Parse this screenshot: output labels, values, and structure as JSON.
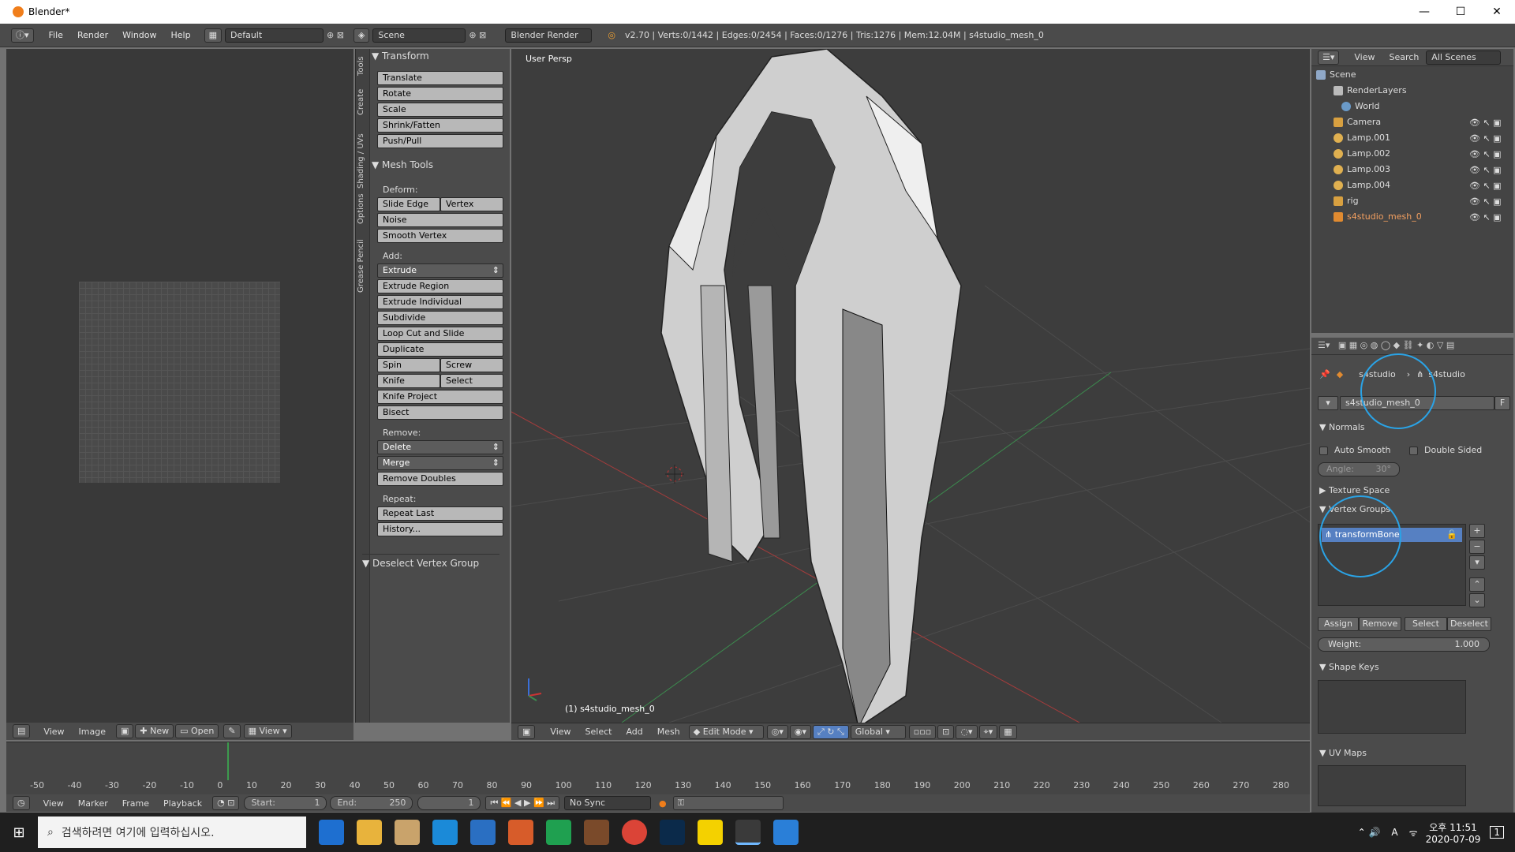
{
  "window": {
    "title": "Blender*",
    "minimize": "—",
    "maximize": "☐",
    "close": "✕"
  },
  "menubar": {
    "menus": [
      "File",
      "Render",
      "Window",
      "Help"
    ],
    "layout": "Default",
    "scene": "Scene",
    "engine": "Blender Render",
    "info": "v2.70 | Verts:0/1442 | Edges:0/2454 | Faces:0/1276 | Tris:1276 | Mem:12.04M | s4studio_mesh_0"
  },
  "tool_tabs": [
    "Tools",
    "Create",
    "Shading / UVs",
    "Options",
    "Grease Pencil"
  ],
  "toolshelf": {
    "transform_header": "Transform",
    "transform": [
      "Translate",
      "Rotate",
      "Scale",
      "Shrink/Fatten",
      "Push/Pull"
    ],
    "mesh_tools_header": "Mesh Tools",
    "deform_label": "Deform:",
    "slide_edge": "Slide Edge",
    "vertex": "Vertex",
    "noise": "Noise",
    "smooth_vertex": "Smooth Vertex",
    "add_label": "Add:",
    "extrude": "Extrude",
    "extrude_region": "Extrude Region",
    "extrude_individual": "Extrude Individual",
    "subdivide": "Subdivide",
    "loop_cut": "Loop Cut and Slide",
    "duplicate": "Duplicate",
    "spin": "Spin",
    "screw": "Screw",
    "knife": "Knife",
    "select": "Select",
    "knife_project": "Knife Project",
    "bisect": "Bisect",
    "remove_label": "Remove:",
    "delete": "Delete",
    "merge": "Merge",
    "remove_doubles": "Remove Doubles",
    "repeat_label": "Repeat:",
    "repeat_last": "Repeat Last",
    "history": "History...",
    "operator_panel": "Deselect Vertex Group"
  },
  "viewport": {
    "view_label": "User Persp",
    "object_label": "(1) s4studio_mesh_0",
    "header": [
      "View",
      "Select",
      "Add",
      "Mesh"
    ],
    "mode": "Edit Mode",
    "orientation": "Global"
  },
  "image_editor": {
    "header": [
      "View",
      "Image"
    ],
    "new": "New",
    "open": "Open",
    "view": "View"
  },
  "timeline": {
    "ticks": [
      "-50",
      "-40",
      "-30",
      "-20",
      "-10",
      "0",
      "10",
      "20",
      "30",
      "40",
      "50",
      "60",
      "70",
      "80",
      "90",
      "100",
      "110",
      "120",
      "130",
      "140",
      "150",
      "160",
      "170",
      "180",
      "190",
      "200",
      "210",
      "220",
      "230",
      "240",
      "250",
      "260",
      "270",
      "280"
    ],
    "header": [
      "View",
      "Marker",
      "Frame",
      "Playback"
    ],
    "start_label": "Start:",
    "start": "1",
    "end_label": "End:",
    "end": "250",
    "current": "1",
    "sync": "No Sync"
  },
  "outliner": {
    "header": [
      "View",
      "Search",
      "All Scenes"
    ],
    "items": [
      "Scene",
      "RenderLayers",
      "World",
      "Camera",
      "Lamp.001",
      "Lamp.002",
      "Lamp.003",
      "Lamp.004",
      "rig",
      "s4studio_mesh_0"
    ]
  },
  "properties": {
    "breadcrumb_object": "s4studio",
    "breadcrumb_data": "s4studio",
    "mesh_name": "s4studio_mesh_0",
    "fake_user": "F",
    "normals_header": "Normals",
    "auto_smooth": "Auto Smooth",
    "double_sided": "Double Sided",
    "angle": "Angle:",
    "angle_value": "30°",
    "texture_space": "Texture Space",
    "vertex_groups_header": "Vertex Groups",
    "vertex_group": "transformBone",
    "assign": "Assign",
    "remove": "Remove",
    "select": "Select",
    "deselect": "Deselect",
    "weight_label": "Weight:",
    "weight_value": "1.000",
    "shape_keys": "Shape Keys",
    "uv_maps": "UV Maps"
  },
  "taskbar": {
    "search_placeholder": "검색하려면 여기에 입력하십시오.",
    "time": "오후 11:51",
    "date": "2020-07-09",
    "ime": "A",
    "notifications": "1"
  },
  "colors": {
    "accent_circle": "#2aa3e6",
    "selected_group": "#5680c2",
    "blender_orange": "#f07e1b"
  }
}
